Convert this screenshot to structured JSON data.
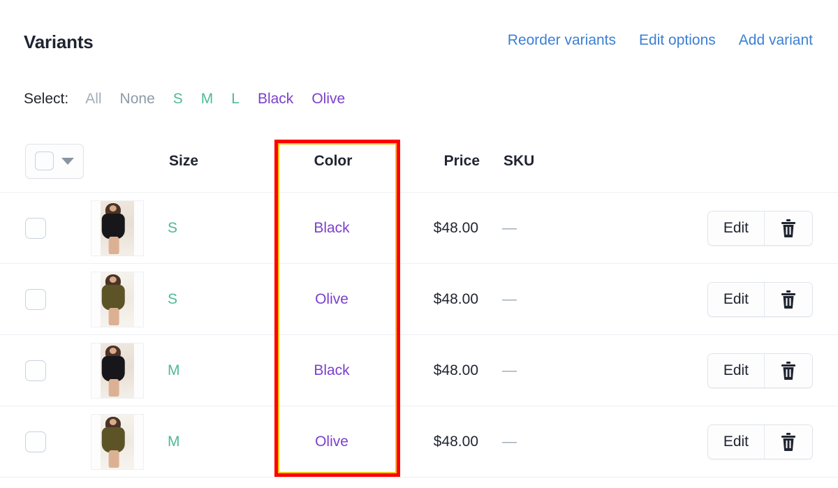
{
  "header": {
    "title": "Variants",
    "actions": [
      {
        "label": "Reorder variants",
        "name": "reorder-variants-link"
      },
      {
        "label": "Edit options",
        "name": "edit-options-link"
      },
      {
        "label": "Add variant",
        "name": "add-variant-link"
      }
    ],
    "link_color": "#3b7fd4"
  },
  "select_bar": {
    "label": "Select:",
    "chips": [
      {
        "label": "All",
        "kind": "muted-light"
      },
      {
        "label": "None",
        "kind": "muted"
      },
      {
        "label": "S",
        "kind": "size"
      },
      {
        "label": "M",
        "kind": "size"
      },
      {
        "label": "L",
        "kind": "size"
      },
      {
        "label": "Black",
        "kind": "color"
      },
      {
        "label": "Olive",
        "kind": "color"
      }
    ],
    "size_color": "#4fba92",
    "color_color": "#7b40cc",
    "muted_color": "#8e9aa8"
  },
  "table": {
    "columns": {
      "size": "Size",
      "color": "Color",
      "price": "Price",
      "sku": "SKU"
    },
    "rows": [
      {
        "size": "S",
        "color": "Black",
        "price": "$48.00",
        "sku": "—",
        "edit_label": "Edit",
        "thumb": "black-dress-thumbnail"
      },
      {
        "size": "S",
        "color": "Olive",
        "price": "$48.00",
        "sku": "—",
        "edit_label": "Edit",
        "thumb": "olive-dress-thumbnail"
      },
      {
        "size": "M",
        "color": "Black",
        "price": "$48.00",
        "sku": "—",
        "edit_label": "Edit",
        "thumb": "black-dress-thumbnail"
      },
      {
        "size": "M",
        "color": "Olive",
        "price": "$48.00",
        "sku": "—",
        "edit_label": "Edit",
        "thumb": "olive-dress-thumbnail"
      }
    ]
  },
  "annotation": {
    "name": "color-column-highlight",
    "border_color": "#ff0000",
    "inner_color": "#f5c518"
  }
}
